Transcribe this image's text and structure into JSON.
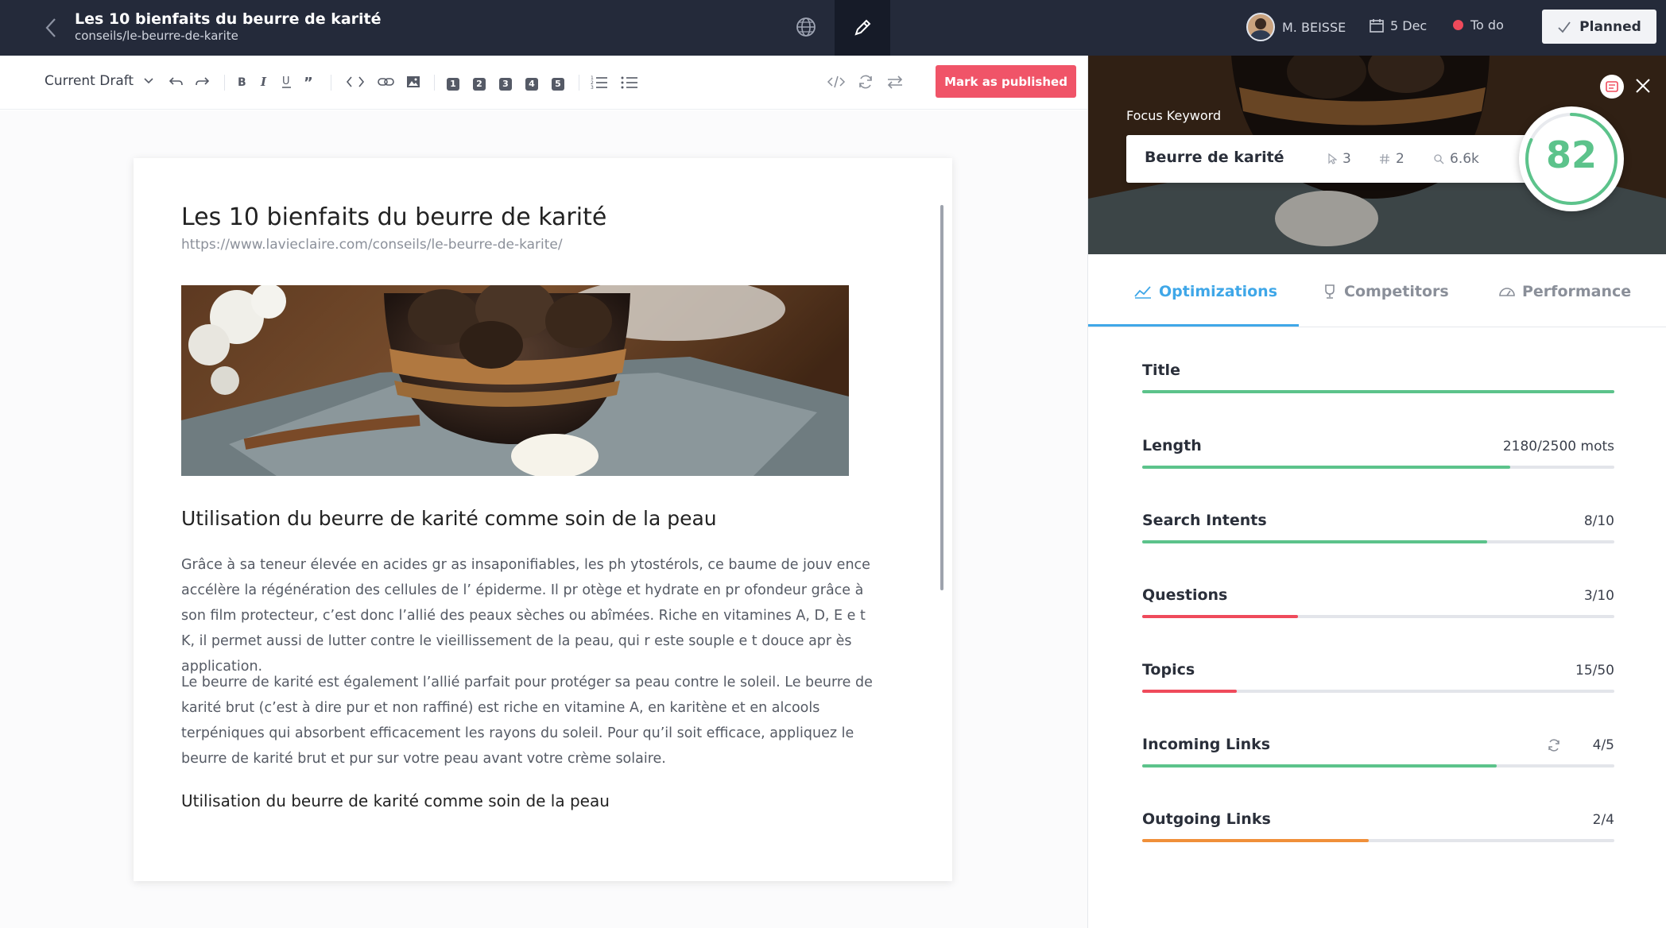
{
  "header": {
    "title": "Les 10 bienfaits du beurre de karité",
    "slug": "conseils/le-beurre-de-karite",
    "user": "M. BEISSE",
    "date": "5 Dec",
    "status": "To do",
    "planned_label": "Planned",
    "status_color": "#ef4a5b"
  },
  "toolbar": {
    "version_select": "Current Draft",
    "publish_label": "Mark as published",
    "heading_buttons": [
      "1",
      "2",
      "3",
      "4",
      "5"
    ],
    "icons": [
      "undo-icon",
      "redo-icon",
      "bold-icon",
      "italic-icon",
      "underline-icon",
      "quote-icon",
      "code-icon",
      "link-icon",
      "image-icon",
      "ordered-list-icon",
      "bullet-list-icon",
      "html-icon",
      "refresh-icon",
      "swap-icon"
    ]
  },
  "article": {
    "title": "Les 10 bienfaits du beurre de karité",
    "url": "https://www.lavieclaire.com/conseils/le-beurre-de-karite/",
    "h2": "Utilisation du beurre de karité comme soin de la peau",
    "p1": "Grâce à sa teneur élevée en acides gr as insaponifiables, les ph ytostérols, ce baume de jouv ence accélère la régénération des cellules de l’ épiderme. Il pr otège et hydrate en pr ofondeur grâce à son film protecteur, c’est donc l’allié des peaux sèches ou abîmées. Riche en vitamines A, D, E e t K, il permet aussi de lutter contre le vieillissement de la peau, qui r este souple e t douce apr ès application.",
    "p2": "Le beurre de karité est également l’allié parfait pour protéger sa peau contre le soleil. Le beurre de karité brut (c’est à dire pur et non raffiné) est riche en vitamine A, en karitène et en alcools terpéniques qui absorbent efficacement les rayons du soleil. Pour qu’il soit efficace, appliquez le beurre de karité brut et pur sur votre peau avant votre crème solaire.",
    "h3": "Utilisation du beurre de karité comme soin de la peau"
  },
  "panel": {
    "focus_label": "Focus Keyword",
    "keyword": "Beurre de karité",
    "clicks": "3",
    "rank": "2",
    "volume": "6.6k",
    "score": "82",
    "score_fraction": 0.82,
    "tabs": [
      {
        "label": "Optimizations",
        "icon": "chart-line-icon"
      },
      {
        "label": "Competitors",
        "icon": "trophy-icon"
      },
      {
        "label": "Performance",
        "icon": "gauge-icon"
      }
    ],
    "metrics": [
      {
        "name": "Title",
        "value": "",
        "fraction": 1.0,
        "color": "#5cc38b"
      },
      {
        "name": "Length",
        "value": "2180/2500 mots",
        "fraction": 0.78,
        "color": "#5cc38b"
      },
      {
        "name": "Search Intents",
        "value": "8/10",
        "fraction": 0.73,
        "color": "#5cc38b"
      },
      {
        "name": "Questions",
        "value": "3/10",
        "fraction": 0.33,
        "color": "#ef4a5b"
      },
      {
        "name": "Topics",
        "value": "15/50",
        "fraction": 0.2,
        "color": "#ef4a5b"
      },
      {
        "name": "Incoming Links",
        "value": "4/5",
        "fraction": 0.75,
        "color": "#5cc38b"
      },
      {
        "name": "Outgoing Links",
        "value": "2/4",
        "fraction": 0.48,
        "color": "#f0903a"
      }
    ]
  }
}
